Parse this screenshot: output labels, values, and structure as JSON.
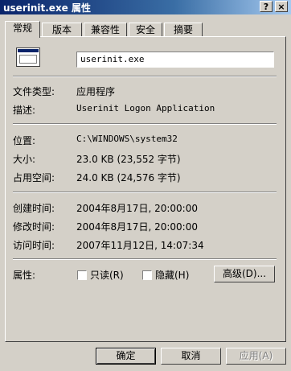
{
  "window": {
    "title": "userinit.exe 属性",
    "help_button": "?",
    "close_button": "×"
  },
  "tabs": [
    "常规",
    "版本",
    "兼容性",
    "安全",
    "摘要"
  ],
  "general": {
    "filename": "userinit.exe",
    "type_label": "文件类型:",
    "type_value": "应用程序",
    "desc_label": "描述:",
    "desc_value": "Userinit Logon Application",
    "location_label": "位置:",
    "location_value": "C:\\WINDOWS\\system32",
    "size_label": "大小:",
    "size_value": "23.0 KB (23,552 字节)",
    "disk_size_label": "占用空间:",
    "disk_size_value": "24.0 KB (24,576 字节)",
    "created_label": "创建时间:",
    "created_value": "2004年8月17日, 20:00:00",
    "modified_label": "修改时间:",
    "modified_value": "2004年8月17日, 20:00:00",
    "accessed_label": "访问时间:",
    "accessed_value": "2007年11月12日, 14:07:34",
    "attributes_label": "属性:",
    "readonly_label": "只读(R)",
    "readonly_checked": false,
    "hidden_label": "隐藏(H)",
    "hidden_checked": false,
    "advanced_button": "高级(D)..."
  },
  "footer": {
    "ok": "确定",
    "cancel": "取消",
    "apply": "应用(A)"
  }
}
